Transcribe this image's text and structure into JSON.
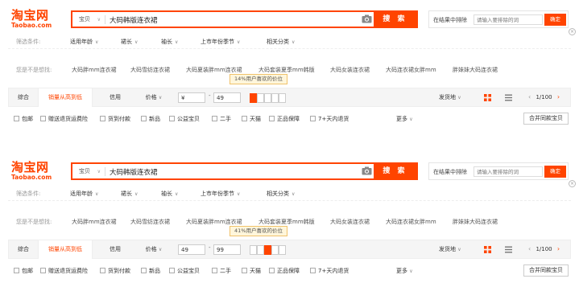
{
  "brand": {
    "name_cn": "淘宝网",
    "name_en": "Taobao.com",
    "accent": "#ff4400"
  },
  "panels": [
    {
      "search": {
        "category": "宝贝",
        "query": "大码韩版连衣裙",
        "button": "搜 索",
        "camera_icon": "camera-icon"
      },
      "within": {
        "label": "在结果中排除",
        "placeholder": "请输入要排除的词",
        "button": "确定"
      },
      "filters": {
        "title": "筛选条件:",
        "items": [
          "适用年龄",
          "裙长",
          "袖长",
          "上市年份季节",
          "相关分类"
        ]
      },
      "suggest": {
        "title": "您是不是想找:",
        "items": [
          "大码胖mm连衣裙",
          "大码雪纺连衣裙",
          "大码夏装胖mm连衣裙",
          "大码套装夏季mm韩版",
          "大码女装连衣裙",
          "大码连衣裙女胖mm",
          "胖妹妹大码连衣裙"
        ]
      },
      "sortbar": {
        "tabs": [
          "综合",
          "销量从高到低",
          "信用",
          "价格"
        ],
        "active": "销量从高到低",
        "price_min": "¥",
        "price_max": "49",
        "price_dash": "-",
        "tooltip": "14%用户喜欢的价位",
        "hist_selected": 0,
        "ship_from": "发货地",
        "page": "1/100"
      },
      "options": {
        "items": [
          "包邮",
          "赠送退货运费险",
          "货到付款",
          "新品",
          "公益宝贝",
          "二手",
          "天猫",
          "正品保障",
          "7+天内退货"
        ],
        "more": "更多",
        "merge": "合并同款宝贝"
      }
    },
    {
      "search": {
        "category": "宝贝",
        "query": "大码韩版连衣裙",
        "button": "搜 索",
        "camera_icon": "camera-icon"
      },
      "within": {
        "label": "在结果中排除",
        "placeholder": "请输入要排除的词",
        "button": "确定"
      },
      "filters": {
        "title": "筛选条件:",
        "items": [
          "适用年龄",
          "裙长",
          "袖长",
          "上市年份季节",
          "相关分类"
        ]
      },
      "suggest": {
        "title": "您是不是想找:",
        "items": [
          "大码胖mm连衣裙",
          "大码雪纺连衣裙",
          "大码夏装胖mm连衣裙",
          "大码套装夏季mm韩版",
          "大码女装连衣裙",
          "大码连衣裙女胖mm",
          "胖妹妹大码连衣裙"
        ]
      },
      "sortbar": {
        "tabs": [
          "综合",
          "销量从高到低",
          "信用",
          "价格"
        ],
        "active": "销量从高到低",
        "price_min": "49",
        "price_max": "99",
        "price_dash": "-",
        "tooltip": "41%用户喜欢的价位",
        "hist_selected": 2,
        "ship_from": "发货地",
        "page": "1/100"
      },
      "options": {
        "items": [
          "包邮",
          "赠送退货运费险",
          "货到付款",
          "新品",
          "公益宝贝",
          "二手",
          "天猫",
          "正品保障",
          "7+天内退货"
        ],
        "more": "更多",
        "merge": "合并同款宝贝"
      }
    }
  ]
}
